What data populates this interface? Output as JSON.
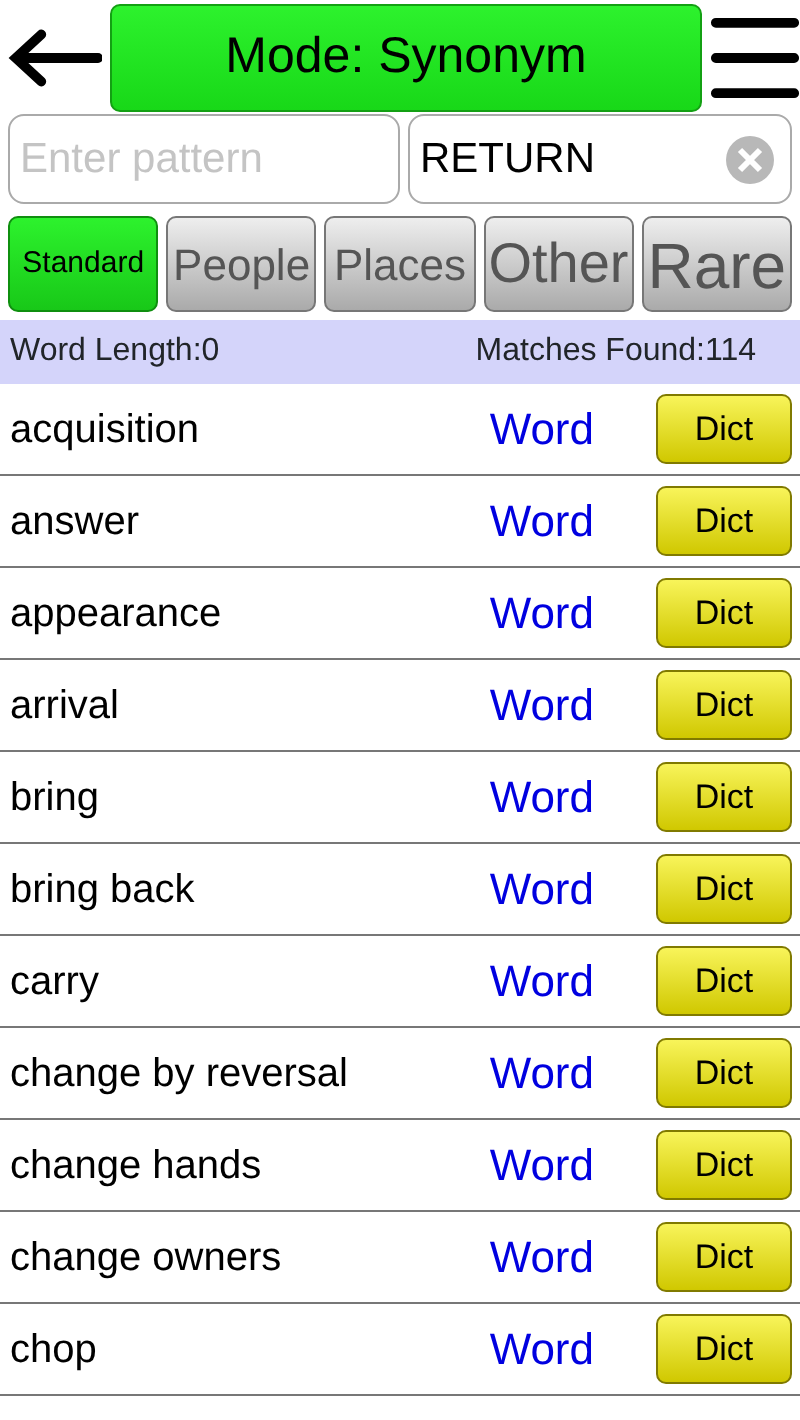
{
  "mode_title": "Mode: Synonym",
  "pattern_field": {
    "placeholder": "Enter pattern"
  },
  "word_field": {
    "value": "RETURN"
  },
  "filters": [
    {
      "label": "Standard",
      "selected": true
    },
    {
      "label": "People",
      "selected": false
    },
    {
      "label": "Places",
      "selected": false
    },
    {
      "label": "Other",
      "selected": false
    },
    {
      "label": "Rare",
      "selected": false
    }
  ],
  "status_bar": {
    "word_length": "Word Length:0",
    "matches": "Matches Found:114"
  },
  "results": [
    {
      "word": "acquisition",
      "link": "Word",
      "button": "Dict"
    },
    {
      "word": "answer",
      "link": "Word",
      "button": "Dict"
    },
    {
      "word": "appearance",
      "link": "Word",
      "button": "Dict"
    },
    {
      "word": "arrival",
      "link": "Word",
      "button": "Dict"
    },
    {
      "word": "bring",
      "link": "Word",
      "button": "Dict"
    },
    {
      "word": "bring back",
      "link": "Word",
      "button": "Dict"
    },
    {
      "word": "carry",
      "link": "Word",
      "button": "Dict"
    },
    {
      "word": "change by reversal",
      "link": "Word",
      "button": "Dict"
    },
    {
      "word": "change hands",
      "link": "Word",
      "button": "Dict"
    },
    {
      "word": "change owners",
      "link": "Word",
      "button": "Dict"
    },
    {
      "word": "chop",
      "link": "Word",
      "button": "Dict"
    }
  ]
}
